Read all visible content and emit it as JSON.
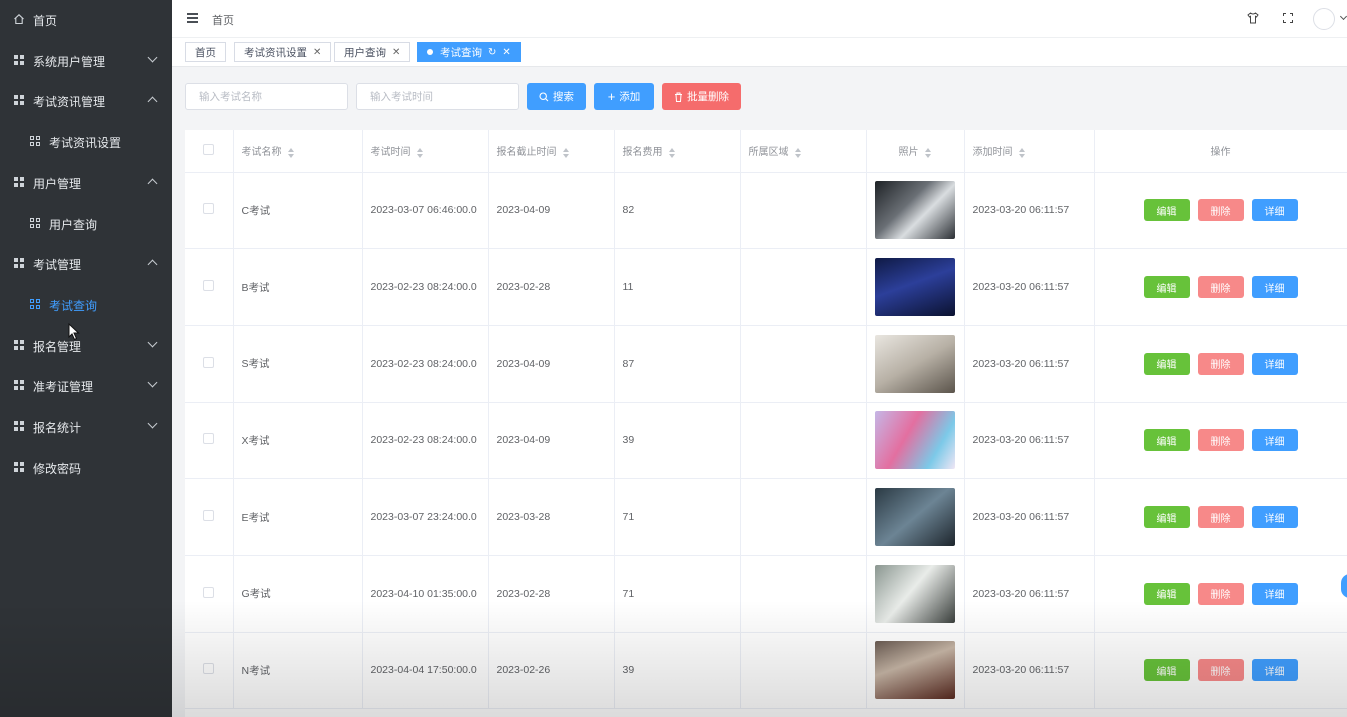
{
  "sidebar": {
    "items": [
      {
        "label": "首页",
        "icon": "home-icon",
        "type": "top"
      },
      {
        "label": "系统用户管理",
        "icon": "grid-icon",
        "type": "group",
        "expanded": false
      },
      {
        "label": "考试资讯管理",
        "icon": "grid-icon",
        "type": "group",
        "expanded": true
      },
      {
        "label": "考试资讯设置",
        "icon": "apps-icon",
        "type": "sub"
      },
      {
        "label": "用户管理",
        "icon": "grid-icon",
        "type": "group",
        "expanded": true
      },
      {
        "label": "用户查询",
        "icon": "apps-icon",
        "type": "sub"
      },
      {
        "label": "考试管理",
        "icon": "grid-icon",
        "type": "group",
        "expanded": true
      },
      {
        "label": "考试查询",
        "icon": "apps-icon",
        "type": "sub",
        "active": true
      },
      {
        "label": "报名管理",
        "icon": "grid-icon",
        "type": "group",
        "expanded": false
      },
      {
        "label": "准考证管理",
        "icon": "grid-icon",
        "type": "group",
        "expanded": false
      },
      {
        "label": "报名统计",
        "icon": "grid-icon",
        "type": "group",
        "expanded": false
      },
      {
        "label": "修改密码",
        "icon": "grid-icon",
        "type": "top"
      }
    ]
  },
  "header": {
    "breadcrumb": "首页"
  },
  "tags": [
    {
      "label": "首页",
      "closable": false,
      "active": false
    },
    {
      "label": "考试资讯设置",
      "closable": true,
      "active": false
    },
    {
      "label": "用户查询",
      "closable": true,
      "active": false
    },
    {
      "label": "考试查询",
      "closable": true,
      "active": true
    }
  ],
  "search": {
    "name_placeholder": "输入考试名称",
    "time_placeholder": "输入考试时间",
    "search_label": "搜索",
    "add_label": "添加",
    "batch_delete_label": "批量删除"
  },
  "table": {
    "headers": [
      "考试名称",
      "考试时间",
      "报名截止时间",
      "报名费用",
      "所属区域",
      "照片",
      "添加时间",
      "操作"
    ],
    "rows": [
      {
        "name": "C考试",
        "time": "2023-03-07 06:46:00.0",
        "deadline": "2023-04-09",
        "fee": "82",
        "region": "",
        "added": "2023-03-20 06:11:57"
      },
      {
        "name": "B考试",
        "time": "2023-02-23 08:24:00.0",
        "deadline": "2023-02-28",
        "fee": "11",
        "region": "",
        "added": "2023-03-20 06:11:57"
      },
      {
        "name": "S考试",
        "time": "2023-02-23 08:24:00.0",
        "deadline": "2023-04-09",
        "fee": "87",
        "region": "",
        "added": "2023-03-20 06:11:57"
      },
      {
        "name": "X考试",
        "time": "2023-02-23 08:24:00.0",
        "deadline": "2023-04-09",
        "fee": "39",
        "region": "",
        "added": "2023-03-20 06:11:57"
      },
      {
        "name": "E考试",
        "time": "2023-03-07 23:24:00.0",
        "deadline": "2023-03-28",
        "fee": "71",
        "region": "",
        "added": "2023-03-20 06:11:57"
      },
      {
        "name": "G考试",
        "time": "2023-04-10 01:35:00.0",
        "deadline": "2023-02-28",
        "fee": "71",
        "region": "",
        "added": "2023-03-20 06:11:57"
      },
      {
        "name": "N考试",
        "time": "2023-04-04 17:50:00.0",
        "deadline": "2023-02-26",
        "fee": "39",
        "region": "",
        "added": "2023-03-20 06:11:57"
      }
    ],
    "ops": {
      "edit": "编辑",
      "delete": "删除",
      "detail": "详细"
    }
  },
  "colors": {
    "sidebar_bg": "#2f3337",
    "accent": "#409eff",
    "edit": "#67c23a",
    "delete": "#f78989"
  }
}
